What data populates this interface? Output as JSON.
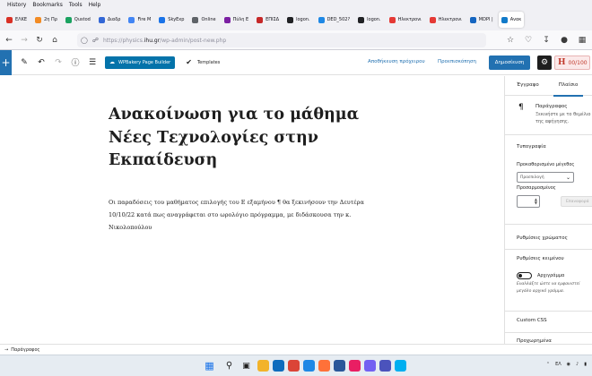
{
  "browser": {
    "menu": [
      "History",
      "Bookmarks",
      "Tools",
      "Help"
    ],
    "tabs": [
      {
        "label": "ΕΛΚΕ",
        "color": "#d93025"
      },
      {
        "label": "2η Πρ",
        "color": "#f28b24"
      },
      {
        "label": "Qustod",
        "color": "#1aa260"
      },
      {
        "label": "Διαδρ",
        "color": "#3367d6"
      },
      {
        "label": "Fire M",
        "color": "#4285f4"
      },
      {
        "label": "SkyExp",
        "color": "#1a73e8"
      },
      {
        "label": "Online",
        "color": "#5f6368"
      },
      {
        "label": "Πύλη Ε",
        "color": "#7b1fa2"
      },
      {
        "label": "ΕΠΙΣΔ",
        "color": "#c62828"
      },
      {
        "label": "logon.",
        "color": "#202124"
      },
      {
        "label": "DED_502?",
        "color": "#1e88e5"
      },
      {
        "label": "logon.",
        "color": "#202124"
      },
      {
        "label": "Ηλεκτρονι",
        "color": "#e53935"
      },
      {
        "label": "Ηλεκτρονι",
        "color": "#e53935"
      },
      {
        "label": "MDPI |",
        "color": "#1565c0"
      },
      {
        "label": "Ανακ",
        "color": "#117ac9",
        "active": true
      }
    ],
    "url_prefix": "https://physics.",
    "url_domain": "ihu.gr",
    "url_path": "/wp-admin/post-new.php"
  },
  "icons": {
    "back": "arrow-left-icon",
    "forward": "arrow-right-icon",
    "reload": "reload-icon",
    "home": "home-icon",
    "shield": "shield-icon",
    "lock": "lock-icon"
  },
  "toolbar": {
    "add_label": "+",
    "wpbakery_label": "WPBakery Page Builder",
    "templates_label": "Templates",
    "save_draft_label": "Αποθήκευση πρόχειρου",
    "preview_label": "Προεπισκόπηση",
    "publish_label": "Δημοσίευση",
    "seo_score": "00/100"
  },
  "post": {
    "title": "Ανακοίνωση για το μάθημα Νέες Τεχνολογίες στην Εκπαίδευση",
    "body": "Οι παραδόσεις του μαθήματος επιλογής του Ε εξαμήνου ¶ θα ξεκινήσουν την Δευτέρα 10/10/22 κατά πως αναγράφεται στο ωρολόγιο πρόγραμμα, με διδάσκουσα την κ. Νικολοπούλου"
  },
  "sidebar": {
    "tab_document": "Έγγραφο",
    "tab_block": "Πλαίσιο",
    "block_name": "Παράγραφος",
    "block_desc_1": "Ξεκινήστε με το θεμέλιο",
    "block_desc_2": "της αφήγησης.",
    "typography": "Τυπογραφία",
    "preset_size_label": "Προκαθορισμένο μέγεθος",
    "preset_size_value": "Προεπιλογή",
    "custom_size_label": "Προσαρμοσμένος",
    "reset_label": "Επαναφορά",
    "color_settings": "Ρυθμίσεις χρώματος",
    "text_settings": "Ρυθμίσεις κειμένου",
    "dropcap_label": "Αρχιγράμμα",
    "dropcap_help_1": "Εναλλάξτε ώστε να εμφανιστεί",
    "dropcap_help_2": "μεγάλο αρχικό γράμμα.",
    "custom_css": "Custom CSS",
    "advanced": "Προχωρημένα"
  },
  "footer": {
    "breadcrumb": "Παράγραφος"
  },
  "taskbar": {
    "lang": "ΕΛ",
    "apps": [
      {
        "name": "file-explorer-icon",
        "color": "#f2b32a"
      },
      {
        "name": "mail-icon",
        "color": "#0f6cbd"
      },
      {
        "name": "chrome-icon",
        "color": "#db4437"
      },
      {
        "name": "edge-icon",
        "color": "#1e88e5"
      },
      {
        "name": "firefox-icon",
        "color": "#ff7139"
      },
      {
        "name": "word-icon",
        "color": "#2b579a"
      },
      {
        "name": "media-icon",
        "color": "#e91e63"
      },
      {
        "name": "viber-icon",
        "color": "#7360f2"
      },
      {
        "name": "teams-icon",
        "color": "#4b53bc"
      },
      {
        "name": "skype-icon",
        "color": "#00aff0"
      }
    ]
  }
}
